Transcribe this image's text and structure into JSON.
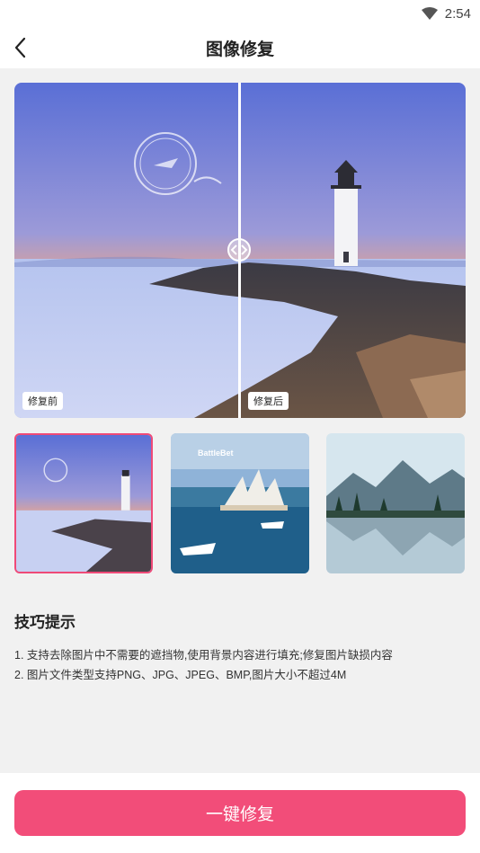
{
  "status": {
    "time": "2:54",
    "wifi_icon": "wifi-icon"
  },
  "header": {
    "title": "图像修复",
    "back_icon": "back-arrow-icon"
  },
  "compare": {
    "before_label": "修复前",
    "after_label": "修复后",
    "divider_icon": "compare-slider-handle-icon"
  },
  "samples": [
    {
      "name": "lighthouse-sample",
      "selected": true
    },
    {
      "name": "sydney-opera-sample",
      "selected": false,
      "watermark": "BattleBet"
    },
    {
      "name": "mountain-lake-sample",
      "selected": false
    }
  ],
  "tips": {
    "title": "技巧提示",
    "items": [
      "1. 支持去除图片中不需要的遮挡物,使用背景内容进行填充;修复图片缺损内容",
      "2. 图片文件类型支持PNG、JPG、JPEG、BMP,图片大小不超过4M"
    ]
  },
  "action": {
    "label": "一键修复",
    "color": "#f24d79"
  }
}
